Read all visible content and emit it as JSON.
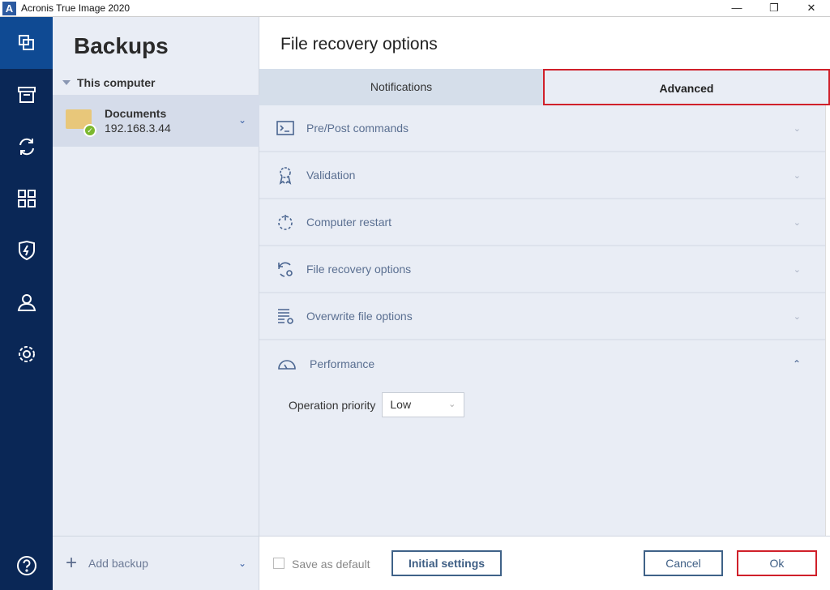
{
  "window": {
    "title": "Acronis True Image 2020",
    "logo": "A",
    "minimize": "—",
    "restore": "❐",
    "close": "✕"
  },
  "nav": {
    "items": [
      "backup-icon",
      "archive-icon",
      "sync-icon",
      "dashboard-icon",
      "protection-icon",
      "account-icon",
      "settings-icon"
    ],
    "help": "help-icon"
  },
  "panel": {
    "title": "Backups",
    "group": "This computer",
    "backup": {
      "name": "Documents",
      "location": "192.168.3.44"
    },
    "add_backup": "Add backup"
  },
  "main": {
    "title": "File recovery options",
    "tabs": [
      {
        "label": "Notifications"
      },
      {
        "label": "Advanced",
        "selected": true
      }
    ],
    "sections": [
      {
        "label": "Pre/Post commands"
      },
      {
        "label": "Validation"
      },
      {
        "label": "Computer restart"
      },
      {
        "label": "File recovery options"
      },
      {
        "label": "Overwrite file options"
      },
      {
        "label": "Performance",
        "expanded": true
      }
    ],
    "performance": {
      "label": "Operation priority",
      "value": "Low"
    }
  },
  "footer": {
    "save_default": "Save as default",
    "save_default_checked": false,
    "initial": "Initial settings",
    "cancel": "Cancel",
    "ok": "Ok"
  },
  "colors": {
    "nav": "#0a2756",
    "nav_active": "#0f4a93",
    "highlight": "#d0202a",
    "panel": "#e9edf5"
  }
}
